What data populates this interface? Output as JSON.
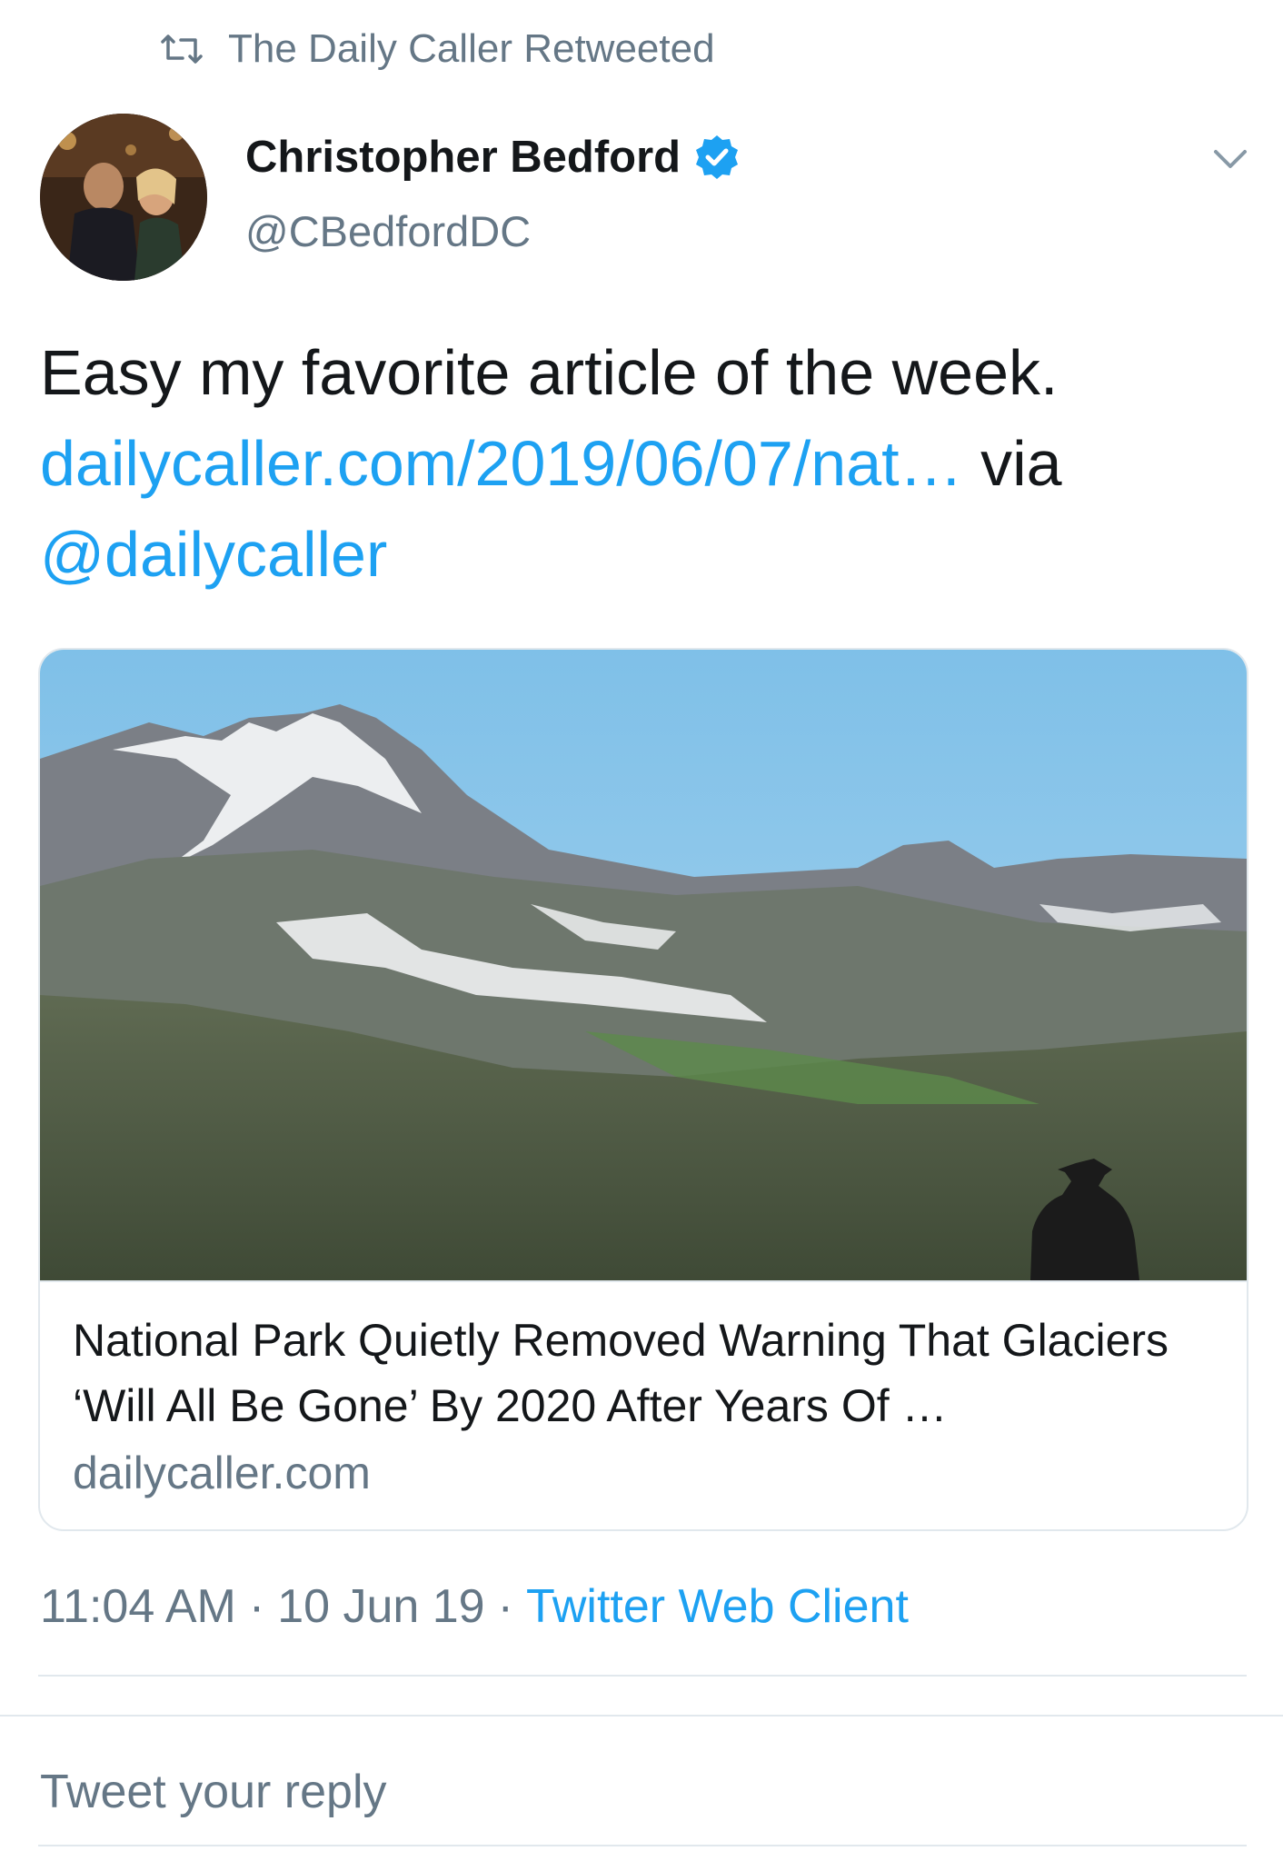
{
  "retweet": {
    "icon": "retweet-icon",
    "label": "The Daily Caller Retweeted"
  },
  "author": {
    "name": "Christopher Bedford",
    "handle": "@CBedfordDC",
    "verified": true,
    "verified_icon": "verified-badge-icon",
    "menu_icon": "chevron-down-icon"
  },
  "tweet": {
    "text": "Easy my favorite article of the week.",
    "link": "dailycaller.com/2019/06/07/nat…",
    "via": "via",
    "mention": "@dailycaller"
  },
  "card": {
    "image_alt": "mountain-landscape-image",
    "title": "National Park Quietly Removed Warning That Glaciers ‘Will All Be Gone’ By 2020 After Years Of …",
    "domain": "dailycaller.com"
  },
  "meta": {
    "time": "11:04 AM",
    "separator": "·",
    "date": "10 Jun 19",
    "client": "Twitter Web Client"
  },
  "reply": {
    "placeholder": "Tweet your reply"
  },
  "colors": {
    "accent": "#1da1f2",
    "secondary_text": "#657786",
    "border": "#e1e8ed"
  }
}
